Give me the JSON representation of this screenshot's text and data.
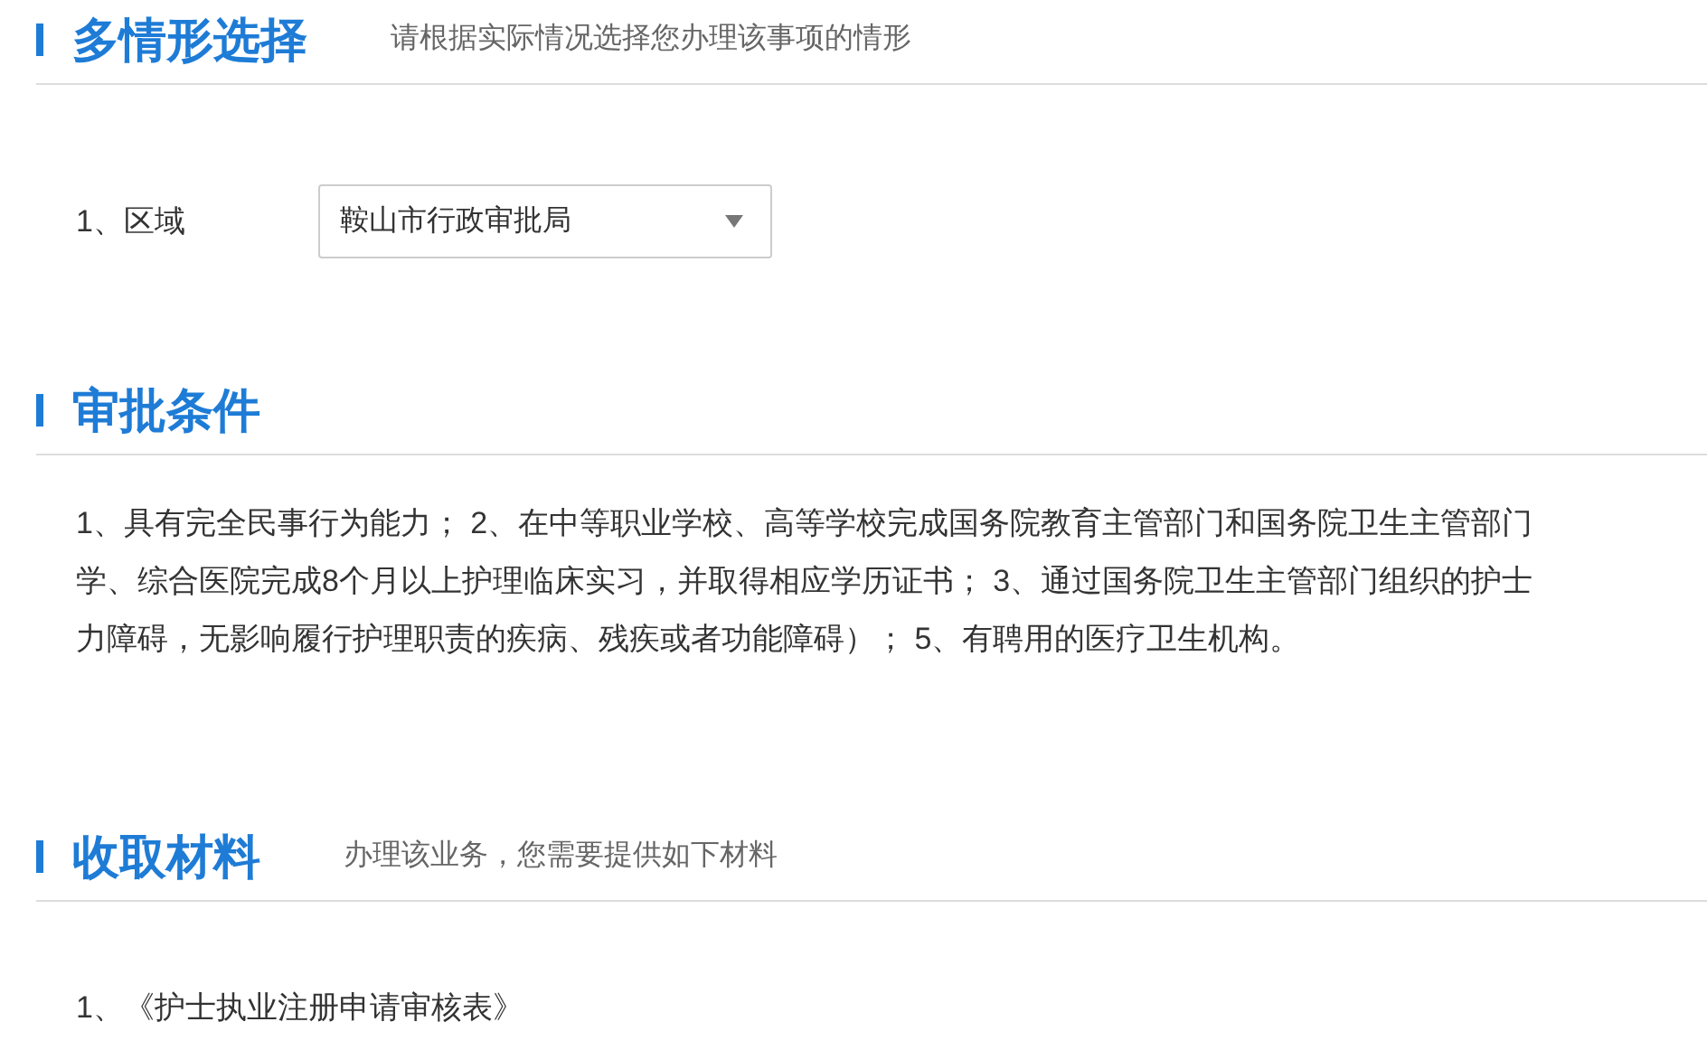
{
  "sections": [
    {
      "title": "多情形选择",
      "subtitle": "请根据实际情况选择您办理该事项的情形",
      "kind": "select",
      "fields": [
        {
          "label": "1、区域",
          "value": "鞍山市行政审批局"
        }
      ]
    },
    {
      "title": "审批条件",
      "kind": "text",
      "lines": [
        "1、具有完全民事行为能力； 2、在中等职业学校、高等学校完成国务院教育主管部门和国务院卫生主管部门",
        "学、综合医院完成8个月以上护理临床实习，并取得相应学历证书； 3、通过国务院卫生主管部门组织的护士",
        "力障碍，无影响履行护理职责的疾病、残疾或者功能障碍）； 5、有聘用的医疗卫生机构。"
      ]
    },
    {
      "title": "收取材料",
      "subtitle": "办理该业务，您需要提供如下材料",
      "kind": "list",
      "items": [
        "1、《护士执业注册申请审核表》"
      ]
    }
  ]
}
